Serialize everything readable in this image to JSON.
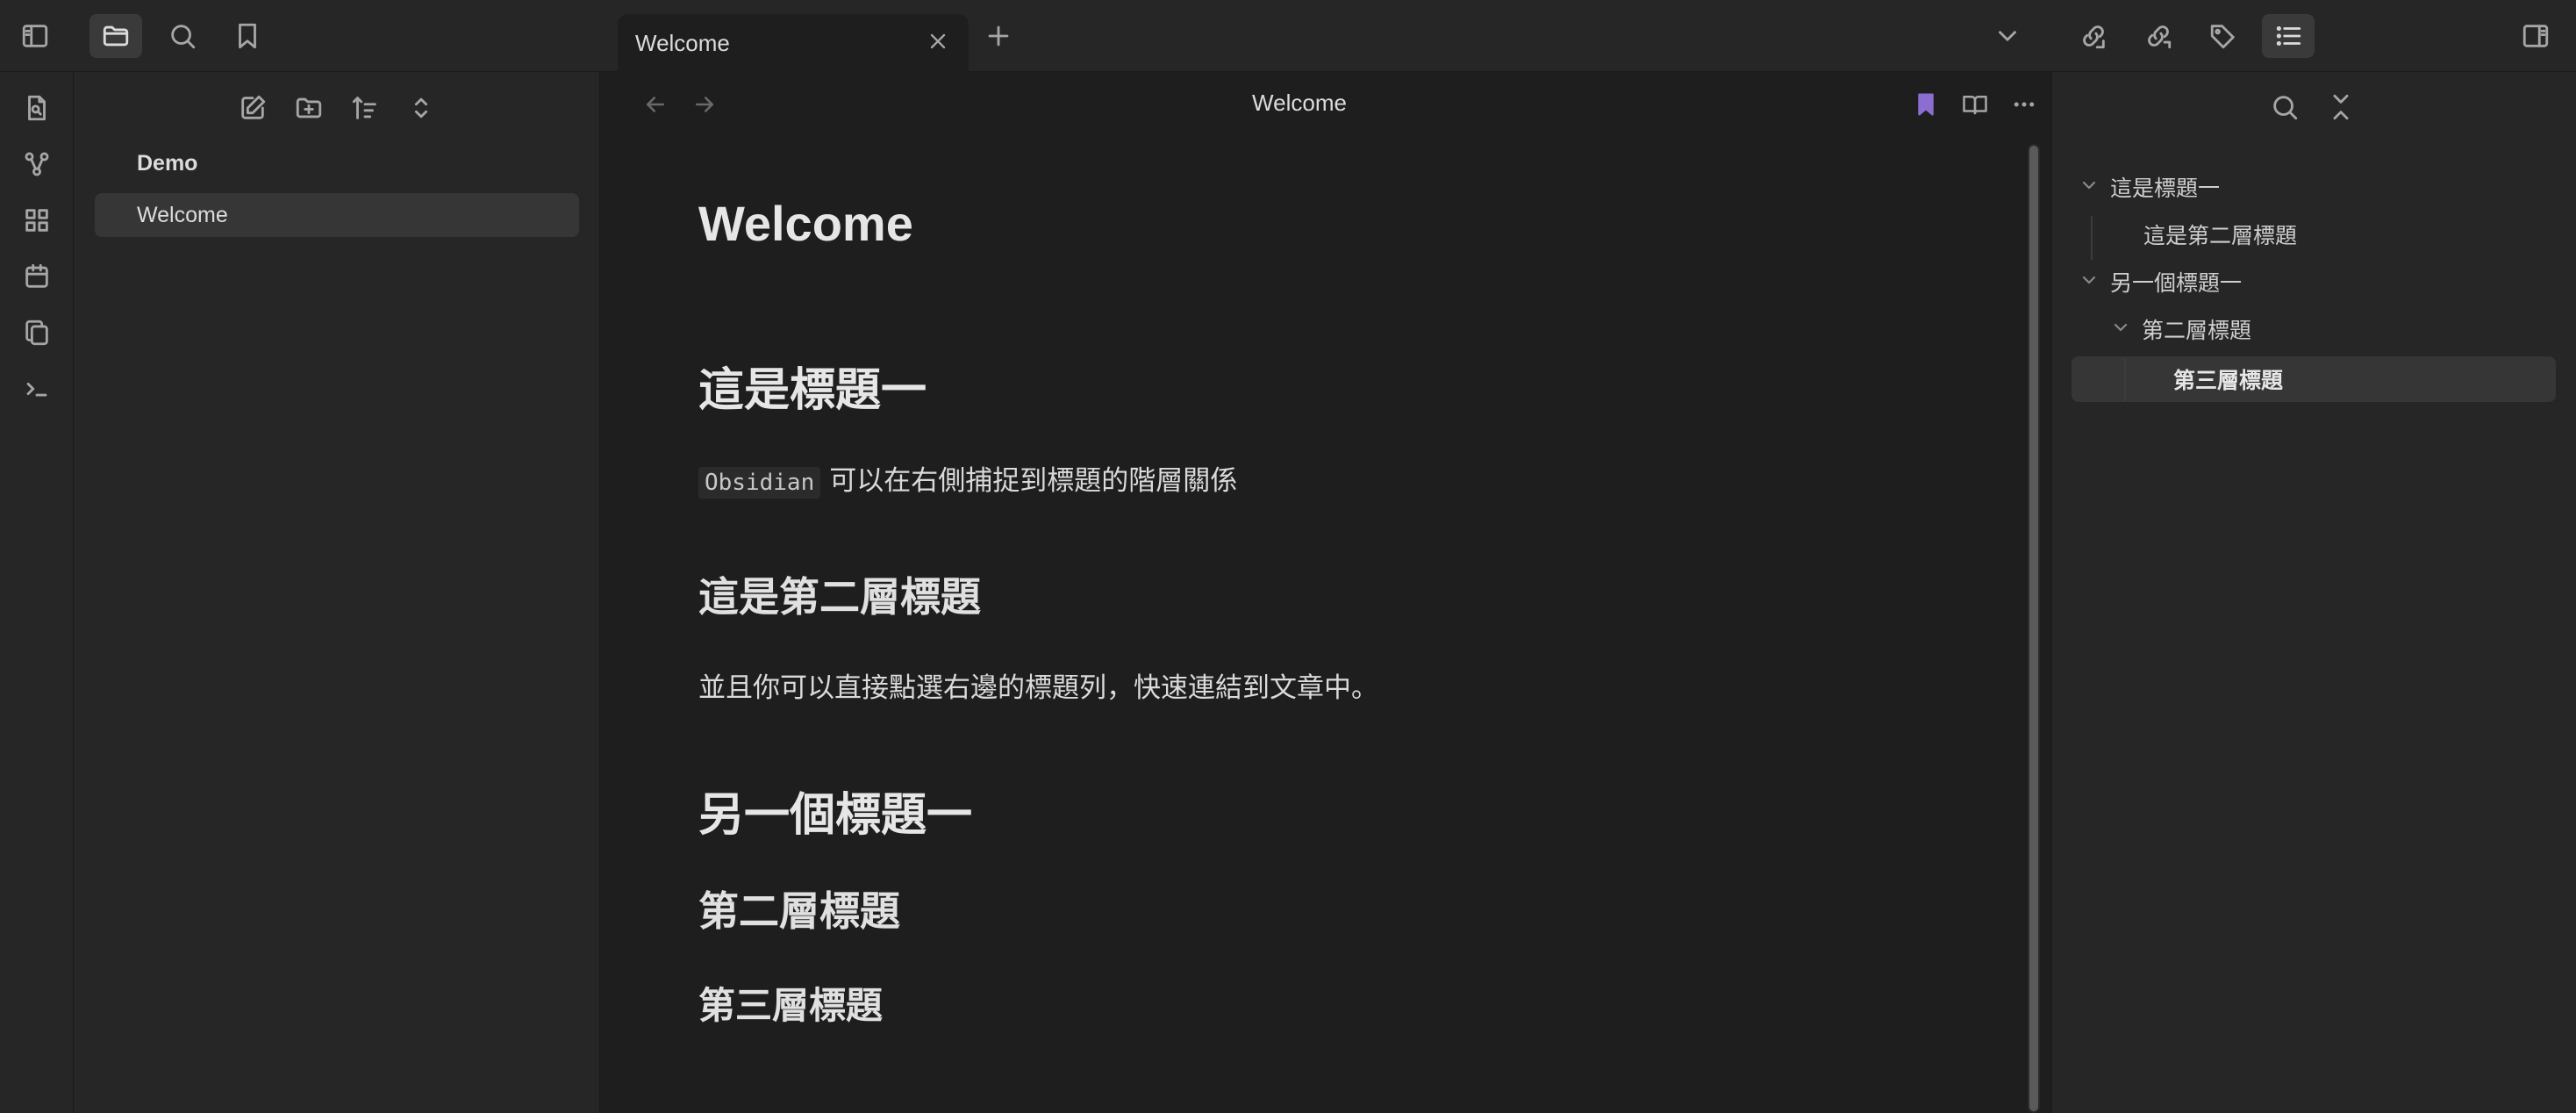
{
  "topbar": {
    "icons": [
      "sidebar-left-icon",
      "folder-icon",
      "search-icon",
      "bookmark-icon"
    ],
    "tab": {
      "label": "Welcome"
    },
    "right_icons": [
      "chevron-down-icon",
      "backlinks-icon",
      "outgoing-links-icon",
      "tags-icon",
      "outline-list-icon",
      "sidebar-right-icon"
    ]
  },
  "ribbon": {
    "icons": [
      "file-search-icon",
      "graph-icon",
      "canvas-icon",
      "calendar-icon",
      "copy-icon",
      "terminal-icon"
    ]
  },
  "explorer": {
    "toolbar": [
      "new-note-icon",
      "new-folder-icon",
      "sort-icon",
      "collapse-icon"
    ],
    "folder": "Demo",
    "files": [
      "Welcome"
    ]
  },
  "editor": {
    "view_title": "Welcome",
    "title": "Welcome",
    "sections": {
      "h1_a": "這是標題一",
      "para_a_code": "Obsidian",
      "para_a_text": "可以在右側捕捉到標題的階層關係",
      "h2_a": "這是第二層標題",
      "para_b": "並且你可以直接點選右邊的標題列，快速連結到文章中。",
      "h1_b": "另一個標題一",
      "h2_b": "第二層標題",
      "h3_b": "第三層標題"
    }
  },
  "outline": {
    "items": [
      {
        "label": "這是標題一",
        "level": 1
      },
      {
        "label": "這是第二層標題",
        "level": 2
      },
      {
        "label": "另一個標題一",
        "level": 1
      },
      {
        "label": "第二層標題",
        "level": 2
      },
      {
        "label": "第三層標題",
        "level": 3,
        "selected": true
      }
    ]
  },
  "colors": {
    "accent": "#8b6ecf",
    "background": "#1e1e1e",
    "panel": "#262626"
  }
}
